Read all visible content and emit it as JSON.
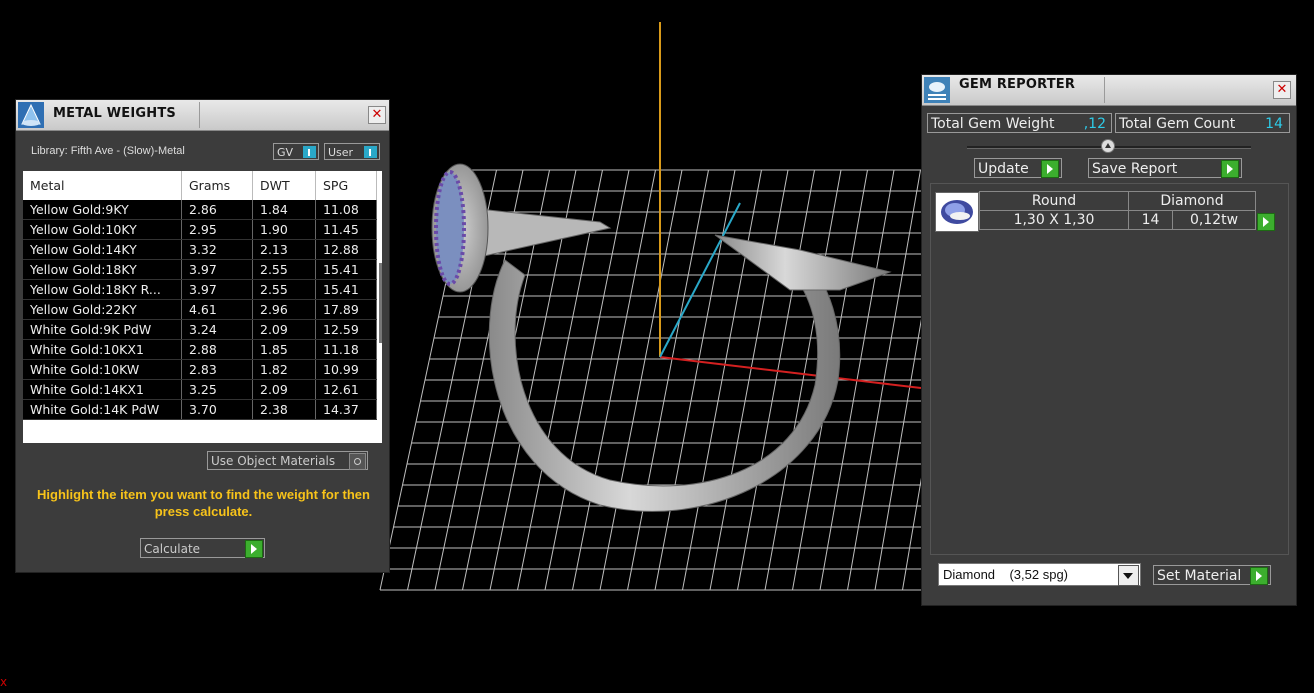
{
  "metal_weights": {
    "title": "METAL WEIGHTS",
    "library": "Library: Fifth Ave - (Slow)-Metal",
    "toggle_gv": "GV",
    "toggle_user": "User",
    "columns": [
      "Metal",
      "Grams",
      "DWT",
      "SPG"
    ],
    "rows": [
      [
        "Yellow Gold:9KY",
        "2.86",
        "1.84",
        "11.08"
      ],
      [
        "Yellow Gold:10KY",
        "2.95",
        "1.90",
        "11.45"
      ],
      [
        "Yellow Gold:14KY",
        "3.32",
        "2.13",
        "12.88"
      ],
      [
        "Yellow Gold:18KY",
        "3.97",
        "2.55",
        "15.41"
      ],
      [
        "Yellow Gold:18KY R...",
        "3.97",
        "2.55",
        "15.41"
      ],
      [
        "Yellow Gold:22KY",
        "4.61",
        "2.96",
        "17.89"
      ],
      [
        "White Gold:9K PdW",
        "3.24",
        "2.09",
        "12.59"
      ],
      [
        "White Gold:10KX1",
        "2.88",
        "1.85",
        "11.18"
      ],
      [
        "White Gold:10KW",
        "2.83",
        "1.82",
        "10.99"
      ],
      [
        "White Gold:14KX1",
        "3.25",
        "2.09",
        "12.61"
      ],
      [
        "White Gold:14K PdW",
        "3.70",
        "2.38",
        "14.37"
      ]
    ],
    "use_object_materials": "Use Object Materials",
    "hint": "Highlight the item you want to find the weight for then press calculate.",
    "calculate": "Calculate"
  },
  "gem_reporter": {
    "title": "GEM REPORTER",
    "total_weight_label": "Total Gem Weight",
    "total_weight_value": ",12",
    "total_count_label": "Total Gem Count",
    "total_count_value": "14",
    "update": "Update",
    "save_report": "Save Report",
    "gem": {
      "shape": "Round",
      "type": "Diamond",
      "size": "1,30 X 1,30",
      "count": "14",
      "weight": "0,12tw"
    },
    "material_select": "Diamond    (3,52 spg)",
    "set_material": "Set Material"
  },
  "colors": {
    "accent_cyan": "#2ecbe8",
    "hint_yellow": "#f7c31a",
    "arrow_green": "#3cae2e"
  },
  "corner_mark": "x"
}
